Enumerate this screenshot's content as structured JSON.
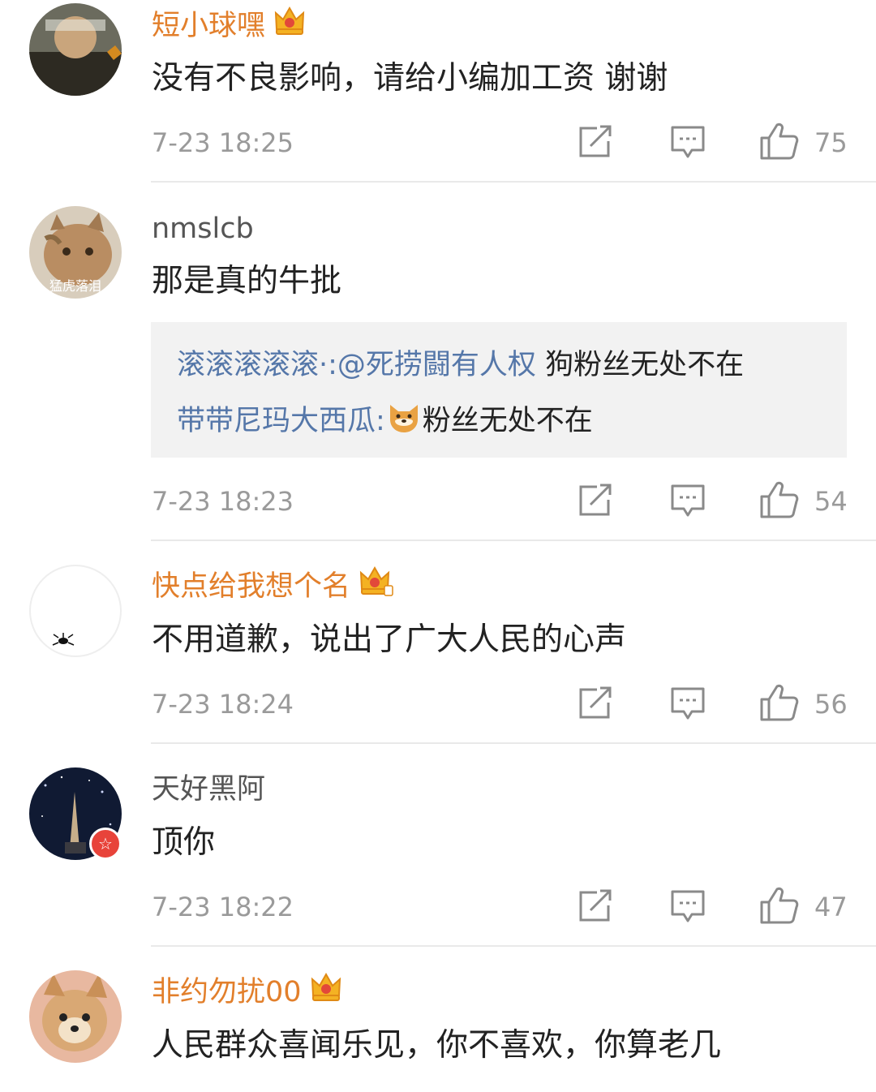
{
  "comments": [
    {
      "username": "短小球嘿",
      "vip": true,
      "text": "没有不良影响，请给小编加工资 谢谢",
      "time": "7-23 18:25",
      "likes": "75"
    },
    {
      "username": "nmslcb",
      "vip": false,
      "avatar_caption": "猛虎落泪",
      "text": "那是真的牛批",
      "replies": [
        {
          "name": "滚滚滚滚滚·:",
          "mention": "@死捞闘有人权",
          "text": " 狗粉丝无处不在"
        },
        {
          "name": "带带尼玛大西瓜:",
          "emoji": "dog-face-emoji",
          "text": "粉丝无处不在"
        }
      ],
      "time": "7-23 18:23",
      "likes": "54"
    },
    {
      "username": "快点给我想个名",
      "vip": true,
      "text": "不用道歉，说出了广大人民的心声",
      "time": "7-23 18:24",
      "likes": "56"
    },
    {
      "username": "天好黑阿",
      "vip": false,
      "verified_badge": true,
      "text": "顶你",
      "time": "7-23 18:22",
      "likes": "47"
    },
    {
      "username": "非约勿扰00",
      "vip": true,
      "text": "人民群众喜闻乐见，你不喜欢，你算老几"
    }
  ],
  "icons": {
    "forward": "share-icon",
    "comment": "comment-icon",
    "like": "thumbs-up-icon",
    "vip": "crown-icon",
    "verified": "verified-star-icon"
  },
  "colors": {
    "vip_name": "#e27f2b",
    "reply_name": "#5577a9",
    "meta_gray": "#9a9a9a",
    "reply_bg": "#f2f2f2",
    "verified_badge": "#e8433a"
  }
}
